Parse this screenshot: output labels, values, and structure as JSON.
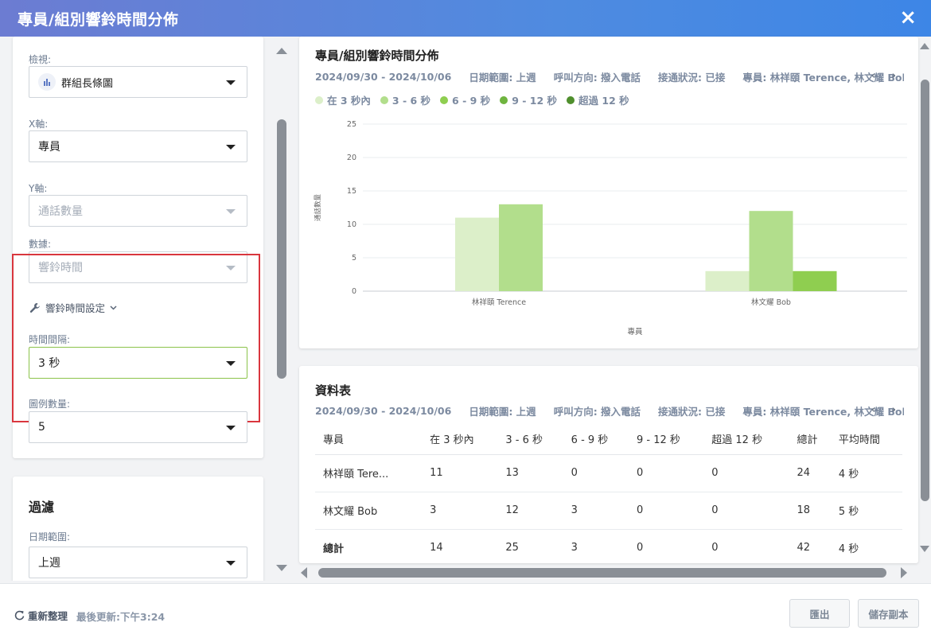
{
  "header": {
    "title": "專員/組別響鈴時間分佈",
    "close_icon": "×"
  },
  "settings": {
    "view": {
      "label": "檢視:",
      "value": "群組長條圖"
    },
    "x_axis": {
      "label": "X軸:",
      "value": "專員"
    },
    "y_axis": {
      "label": "Y軸:",
      "value": "通話數量"
    },
    "data": {
      "label": "數據:",
      "value": "響鈴時間"
    },
    "ring_settings_label": "響鈴時間設定",
    "interval": {
      "label": "時間間隔:",
      "value": "3 秒"
    },
    "legend_count": {
      "label": "圖例數量:",
      "value": "5"
    }
  },
  "filter": {
    "title": "過濾",
    "date_range": {
      "label": "日期範圍:",
      "value": "上週"
    }
  },
  "meta": {
    "dates": "2024/09/30 - 2024/10/06",
    "range": "日期範圍: 上週",
    "direction": "呼叫方向: 撥入電話",
    "status": "接通狀況: 已接",
    "agents": "專員: 林祥頤 Terence, 林文耀 Bob"
  },
  "chart_card": {
    "title": "專員/組別響鈴時間分佈"
  },
  "chart_data": {
    "type": "bar",
    "categories": [
      "林祥頤 Terence",
      "林文耀 Bob"
    ],
    "series": [
      {
        "name": "在 3 秒內",
        "values": [
          11,
          3
        ],
        "color": "#dcefc9"
      },
      {
        "name": "3 - 6 秒",
        "values": [
          13,
          12
        ],
        "color": "#b2de8c"
      },
      {
        "name": "6 - 9 秒",
        "values": [
          0,
          3
        ],
        "color": "#8fce50"
      },
      {
        "name": "9 - 12 秒",
        "values": [
          0,
          0
        ],
        "color": "#6fb43f"
      },
      {
        "name": "超過 12 秒",
        "values": [
          0,
          0
        ],
        "color": "#4f8f2d"
      }
    ],
    "xlabel": "專員",
    "ylabel": "通話數量",
    "ylim": [
      0,
      25
    ],
    "yticks": [
      0,
      5,
      10,
      15,
      20,
      25
    ],
    "grid": true,
    "legend": "top-left"
  },
  "table_card": {
    "title": "資料表",
    "columns": [
      "專員",
      "在 3 秒內",
      "3 - 6 秒",
      "6 - 9 秒",
      "9 - 12 秒",
      "超過 12 秒",
      "總計",
      "平均時間"
    ],
    "rows": [
      [
        "林祥頤 Tere...",
        "11",
        "13",
        "0",
        "0",
        "0",
        "24",
        "4 秒"
      ],
      [
        "林文耀 Bob",
        "3",
        "12",
        "3",
        "0",
        "0",
        "18",
        "5 秒"
      ],
      [
        "總計",
        "14",
        "25",
        "3",
        "0",
        "0",
        "42",
        "4 秒"
      ]
    ]
  },
  "footer": {
    "refresh": "重新整理",
    "last_update": "最後更新:下午3:24",
    "export": "匯出",
    "save_copy": "儲存副本"
  }
}
